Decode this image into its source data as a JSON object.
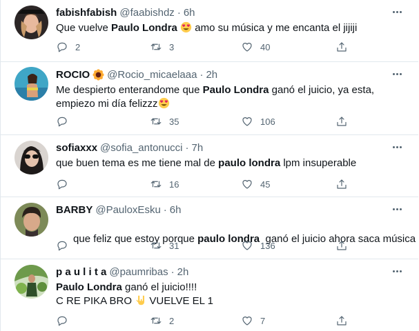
{
  "tweets": [
    {
      "name": "fabishfabish",
      "handle": "@faabishdz",
      "separator": "·",
      "time": "6h",
      "text_pre": "Que vuelve ",
      "text_bold": "Paulo Londra",
      "text_post": " amo su música y me encanta el jijiji",
      "emoji": "heart-eyes-emoji",
      "replies": "2",
      "retweets": "3",
      "likes": "40",
      "avatar_color": "#2f2a28"
    },
    {
      "name": "ROCIO",
      "name_emoji": "sunflower-emoji",
      "handle": "@Rocio_micaelaaa",
      "separator": "·",
      "time": "2h",
      "text_pre": "Me despierto enterandome que ",
      "text_bold": "Paulo Londra",
      "text_post": " ganó el juicio, ya esta, empiezo mi día felizzz",
      "emoji": "heart-eyes-emoji",
      "replies": "",
      "retweets": "35",
      "likes": "106",
      "avatar_color": "#3fa4c2"
    },
    {
      "name": "sofiaxxx",
      "handle": "@sofia_antonucci",
      "separator": "·",
      "time": "7h",
      "text_pre": "que buen tema es me tiene mal de ",
      "text_bold": "paulo londra",
      "text_post": " lpm insuperable",
      "replies": "",
      "retweets": "16",
      "likes": "45",
      "avatar_color": "#3a3433"
    },
    {
      "name": "BARBY",
      "handle": "@PauloxEsku",
      "separator": "·",
      "time": "6h",
      "text_pre": "que feliz que estoy porque ",
      "text_bold": "paulo londra",
      "text_post": "  ganó el juicio ahora saca música",
      "replies": "",
      "retweets": "31",
      "likes": "136",
      "avatar_color": "#5b6a3e"
    },
    {
      "name": "p a u l i t a",
      "handle": "@paumribas",
      "separator": "·",
      "time": "2h",
      "text_bold": "Paulo Londra",
      "text_post": " ganó el juicio!!!!",
      "line2_pre": "C RE PIKA BRO ",
      "line2_post": " VUELVE EL 1",
      "emoji": "rock-hand-emoji",
      "replies": "",
      "retweets": "2",
      "likes": "7",
      "avatar_color": "#4f7a3a"
    }
  ]
}
